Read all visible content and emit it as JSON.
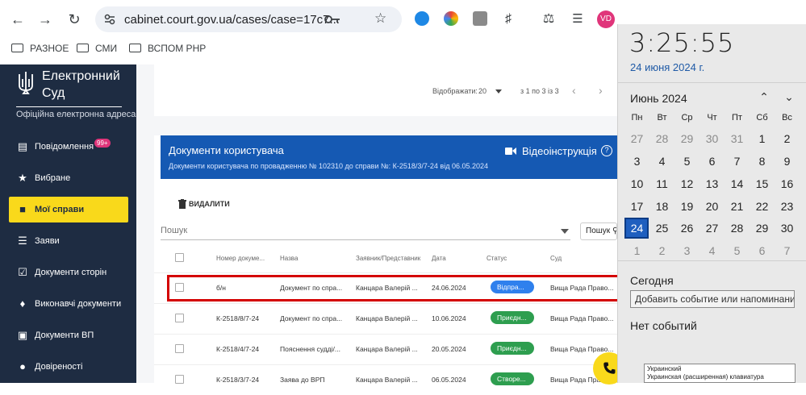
{
  "browser": {
    "url": "cabinet.court.gov.ua/cases/case=17c7...",
    "profile_initials": "VD",
    "bookmarks": [
      "РАЗНОЕ",
      "СМИ",
      "ВСПОМ РНР"
    ]
  },
  "sidebar": {
    "logo_line1": "Електронний",
    "logo_line2": "Суд",
    "logo_sub": "Офіційна електронна адреса",
    "items": [
      {
        "label": "Повідомлення",
        "badge": "99+"
      },
      {
        "label": "Вибране"
      },
      {
        "label": "Мої справи",
        "active": true
      },
      {
        "label": "Заяви"
      },
      {
        "label": "Документи сторін"
      },
      {
        "label": "Виконавчі документи"
      },
      {
        "label": "Документи ВП"
      },
      {
        "label": "Довіреності"
      }
    ]
  },
  "pager": {
    "display_label": "Відображати:",
    "page_size": "20",
    "range": "з 1 по 3 із 3"
  },
  "documents": {
    "title": "Документи користувача",
    "subtitle": "Документи користувача по провадженню № 102310 до справи №: К-2518/3/7-24 від 06.05.2024",
    "video_label": "Відеоінструкція",
    "delete_label": "ВИДАЛИТИ",
    "search_placeholder": "Пошук",
    "search_button": "Пошук",
    "columns": [
      "Номер докуме...",
      "Назва",
      "Заявник/Представник",
      "Дата",
      "Статус",
      "Суд"
    ],
    "rows": [
      {
        "number": "б/н",
        "name": "Документ по спра...",
        "applicant": "Канцара Валерій ...",
        "date": "24.06.2024",
        "status": "Відпра...",
        "status_color": "#2f80ed",
        "court": "Вища Рада Право..."
      },
      {
        "number": "К-2518/8/7-24",
        "name": "Документ по спра...",
        "applicant": "Канцара Валерій ...",
        "date": "10.06.2024",
        "status": "Приєдн...",
        "status_color": "#2e9e4f",
        "court": "Вища Рада Право..."
      },
      {
        "number": "К-2518/4/7-24",
        "name": "Пояснення судді/...",
        "applicant": "Канцара Валерій ...",
        "date": "20.05.2024",
        "status": "Приєдн...",
        "status_color": "#2e9e4f",
        "court": "Вища Рада Право..."
      },
      {
        "number": "К-2518/3/7-24",
        "name": "Заява до ВРП",
        "applicant": "Канцара Валерій ...",
        "date": "06.05.2024",
        "status": "Створе...",
        "status_color": "#2e9e4f",
        "court": "Вища Рада Право..."
      }
    ]
  },
  "calendar": {
    "time": "3:25:55",
    "date_long": "24 июня 2024 г.",
    "month_label": "Июнь 2024",
    "weekdays": [
      "Пн",
      "Вт",
      "Ср",
      "Чт",
      "Пт",
      "Сб",
      "Вс"
    ],
    "weeks": [
      [
        "27",
        "28",
        "29",
        "30",
        "31",
        "1",
        "2"
      ],
      [
        "3",
        "4",
        "5",
        "6",
        "7",
        "8",
        "9"
      ],
      [
        "10",
        "11",
        "12",
        "13",
        "14",
        "15",
        "16"
      ],
      [
        "17",
        "18",
        "19",
        "20",
        "21",
        "22",
        "23"
      ],
      [
        "24",
        "25",
        "26",
        "27",
        "28",
        "29",
        "30"
      ],
      [
        "1",
        "2",
        "3",
        "4",
        "5",
        "6",
        "7"
      ]
    ],
    "today_label": "Сегодня",
    "event_placeholder": "Добавить событие или напоминание",
    "no_events": "Нет событий"
  },
  "ime": {
    "line1": "Украинский",
    "line2": "Украинская (расширенная) клавиатура"
  }
}
